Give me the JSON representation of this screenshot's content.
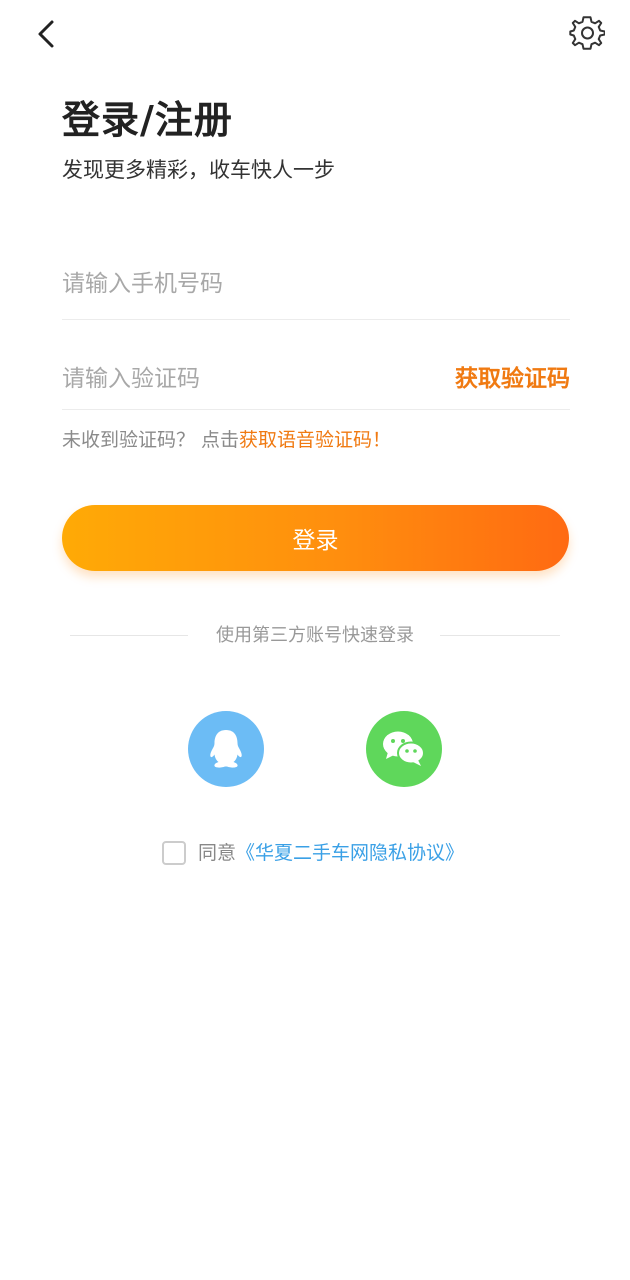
{
  "header": {
    "back_icon": "chevron-left-icon",
    "settings_icon": "gear-icon"
  },
  "title": "登录/注册",
  "subtitle": "发现更多精彩，收车快人一步",
  "phone": {
    "placeholder": "请输入手机号码",
    "value": ""
  },
  "code": {
    "placeholder": "请输入验证码",
    "value": "",
    "get_code_label": "获取验证码"
  },
  "voice_hint": {
    "prefix": "未收到验证码？ 点击",
    "link": "获取语音验证码！"
  },
  "login_button": "登录",
  "third_party": {
    "label": "使用第三方账号快速登录",
    "providers": [
      {
        "name": "QQ",
        "icon": "qq-icon",
        "color": "#6cbcf5"
      },
      {
        "name": "WeChat",
        "icon": "wechat-icon",
        "color": "#5fd75b"
      }
    ]
  },
  "agreement": {
    "checked": false,
    "prefix": "同意",
    "link": "《华夏二手车网隐私协议》"
  },
  "colors": {
    "accent": "#f07a12",
    "gradient_start": "#ffaa06",
    "gradient_end": "#ff6a12",
    "link_blue": "#3aa0e6"
  }
}
